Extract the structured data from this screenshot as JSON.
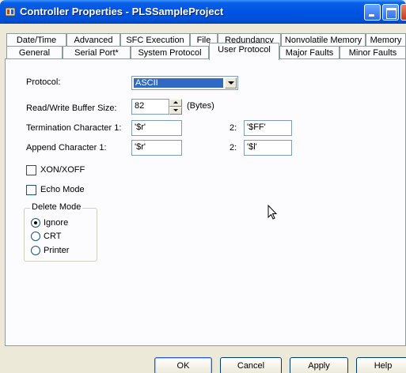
{
  "window": {
    "title": "Controller Properties - PLSSampleProject"
  },
  "tabs": {
    "row1": [
      "Date/Time",
      "Advanced",
      "SFC Execution",
      "File",
      "Redundancy",
      "Nonvolatile Memory",
      "Memory"
    ],
    "row2": [
      "General",
      "Serial Port*",
      "System Protocol",
      "User Protocol",
      "Major Faults",
      "Minor Faults"
    ],
    "active": "User Protocol"
  },
  "form": {
    "protocol_label": "Protocol:",
    "protocol_value": "ASCII",
    "buffer_label": "Read/Write Buffer Size:",
    "buffer_value": "82",
    "buffer_unit": "(Bytes)",
    "term1_label": "Termination Character 1:",
    "term1_value": "'$r'",
    "term2_label": "2:",
    "term2_value": "'$FF'",
    "append1_label": "Append Character 1:",
    "append1_value": "'$r'",
    "append2_label": "2:",
    "append2_value": "'$l'",
    "xon_label": "XON/XOFF",
    "xon_checked": false,
    "echo_label": "Echo Mode",
    "echo_checked": false
  },
  "delete_mode": {
    "title": "Delete Mode",
    "options": [
      "Ignore",
      "CRT",
      "Printer"
    ],
    "selected": "Ignore"
  },
  "buttons": {
    "ok": "OK",
    "cancel": "Cancel",
    "apply": "Apply",
    "help": "Help"
  },
  "colors": {
    "titlebar": "#0054e3",
    "selection": "#316ac5",
    "face": "#ece9d8"
  }
}
